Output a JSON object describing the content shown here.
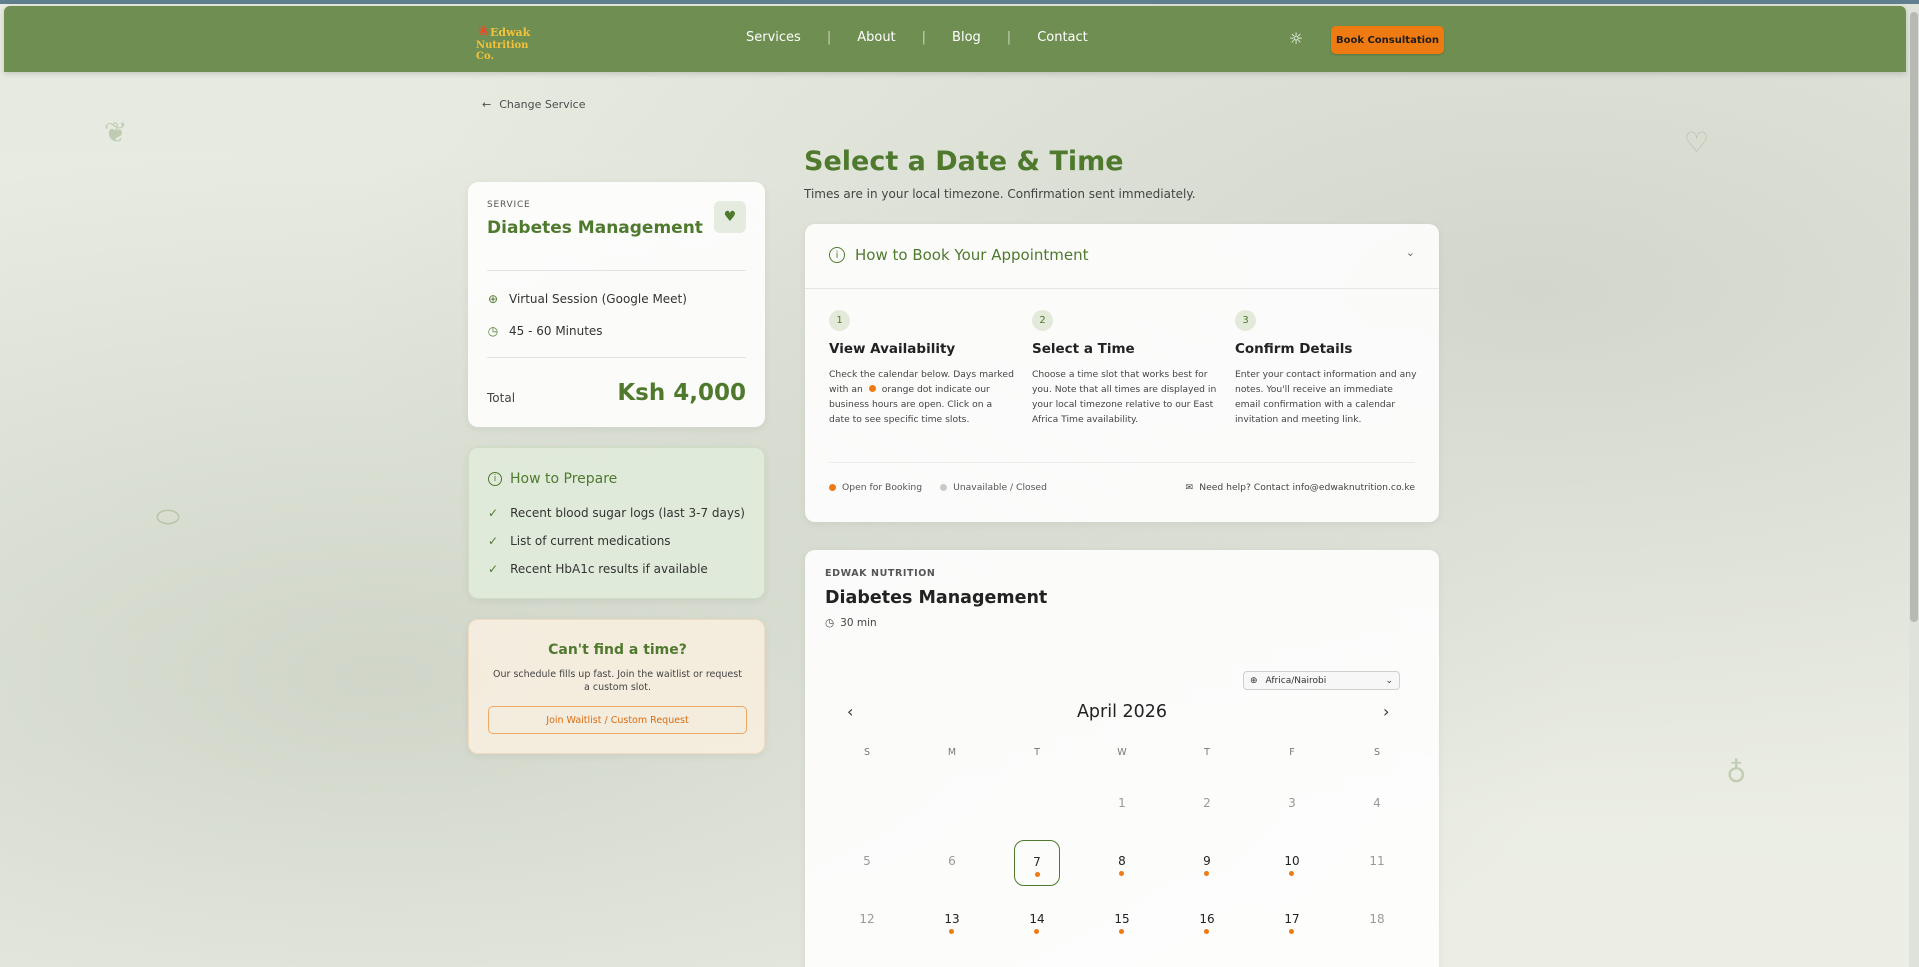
{
  "header": {
    "logo_line1": "Edwak",
    "logo_line2": "Nutrition Co.",
    "nav": [
      "Services",
      "About",
      "Blog",
      "Contact"
    ],
    "book_button": "Book Consultation",
    "theme_icon": "sun-icon"
  },
  "back_link": "Change Service",
  "service_card": {
    "caption": "SERVICE",
    "name": "Diabetes Management",
    "session_type": "Virtual Session (Google Meet)",
    "duration": "45 - 60 Minutes",
    "total_label": "Total",
    "total_value": "Ksh 4,000"
  },
  "prepare": {
    "title": "How to Prepare",
    "items": [
      "Recent blood sugar logs (last 3-7 days)",
      "List of current medications",
      "Recent HbA1c results if available"
    ]
  },
  "waitlist": {
    "title": "Can't find a time?",
    "description": "Our schedule fills up fast. Join the waitlist or request a custom slot.",
    "button": "Join Waitlist / Custom Request"
  },
  "main": {
    "title": "Select a Date & Time",
    "subtitle": "Times are in your local timezone. Confirmation sent immediately."
  },
  "how_to": {
    "title": "How to Book Your Appointment",
    "steps": [
      {
        "num": "1",
        "title": "View Availability",
        "desc_a": "Check the calendar below. Days marked with an",
        "desc_b": "orange dot indicate our business hours are open. Click on a date to see specific time slots."
      },
      {
        "num": "2",
        "title": "Select a Time",
        "desc": "Choose a time slot that works best for you. Note that all times are displayed in your local timezone relative to our East Africa Time availability."
      },
      {
        "num": "3",
        "title": "Confirm Details",
        "desc": "Enter your contact information and any notes. You'll receive an immediate email confirmation with a calendar invitation and meeting link."
      }
    ],
    "legend_open": "Open for Booking",
    "legend_closed": "Unavailable / Closed",
    "help_text": "Need help? Contact info@edwaknutrition.co.ke"
  },
  "calendar": {
    "org": "EDWAK NUTRITION",
    "service": "Diabetes Management",
    "duration": "30 min",
    "timezone": "Africa/Nairobi",
    "month": "April 2026",
    "weekdays": [
      "S",
      "M",
      "T",
      "W",
      "T",
      "F",
      "S"
    ],
    "weeks": [
      [
        null,
        null,
        null,
        {
          "d": "1",
          "s": "muted"
        },
        {
          "d": "2",
          "s": "muted"
        },
        {
          "d": "3",
          "s": "muted"
        },
        {
          "d": "4",
          "s": "muted"
        }
      ],
      [
        {
          "d": "5",
          "s": "muted"
        },
        {
          "d": "6",
          "s": "muted"
        },
        {
          "d": "7",
          "s": "today"
        },
        {
          "d": "8",
          "s": "avail"
        },
        {
          "d": "9",
          "s": "avail"
        },
        {
          "d": "10",
          "s": "avail"
        },
        {
          "d": "11",
          "s": "muted"
        }
      ],
      [
        {
          "d": "12",
          "s": "muted"
        },
        {
          "d": "13",
          "s": "avail"
        },
        {
          "d": "14",
          "s": "avail"
        },
        {
          "d": "15",
          "s": "avail"
        },
        {
          "d": "16",
          "s": "avail"
        },
        {
          "d": "17",
          "s": "avail"
        },
        {
          "d": "18",
          "s": "muted"
        }
      ]
    ]
  },
  "colors": {
    "brand_green": "#4f7a2e",
    "header_green": "#6f8f52",
    "accent_orange": "#ee7a12"
  }
}
